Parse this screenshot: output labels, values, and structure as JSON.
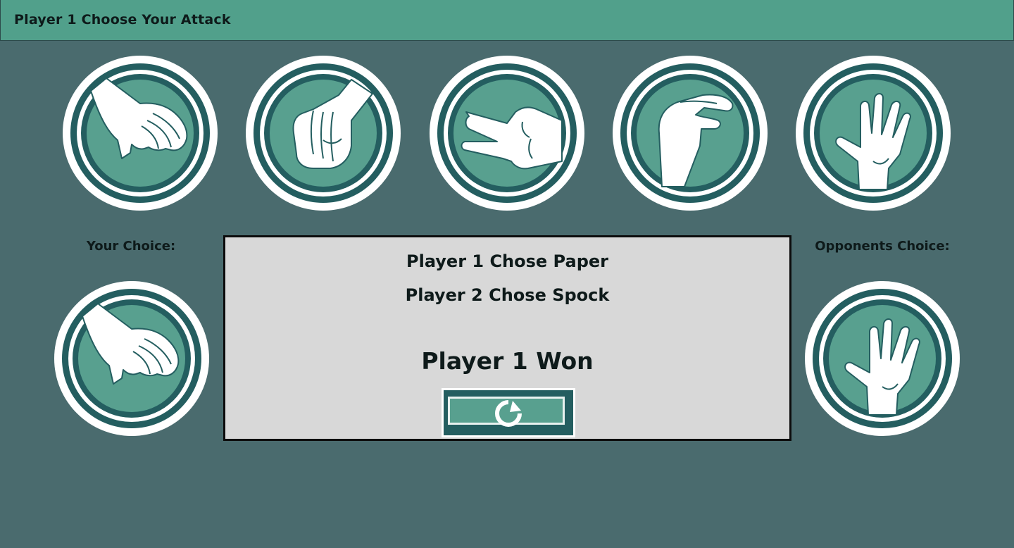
{
  "window": {
    "title": "Player 1 Choose Your Attack"
  },
  "attacks": [
    {
      "name": "Paper",
      "icon": "paper-hand-icon"
    },
    {
      "name": "Rock",
      "icon": "rock-fist-icon"
    },
    {
      "name": "Scissors",
      "icon": "scissors-hand-icon"
    },
    {
      "name": "Lizard",
      "icon": "lizard-hand-icon"
    },
    {
      "name": "Spock",
      "icon": "spock-hand-icon"
    }
  ],
  "your_choice": {
    "label": "Your Choice:",
    "icon": "paper-hand-icon"
  },
  "opponent_choice": {
    "label": "Opponents Choice:",
    "icon": "spock-hand-icon"
  },
  "result": {
    "player1_line": "Player 1 Chose Paper",
    "player2_line": "Player 2 Chose Spock",
    "winner_line": "Player 1 Won",
    "replay_icon": "refresh-icon"
  },
  "colors": {
    "background": "#4a6b6e",
    "titlebar": "#51a08b",
    "icon_dark": "#245e60",
    "icon_light": "#58a08f",
    "panel": "#d8d8d8"
  }
}
